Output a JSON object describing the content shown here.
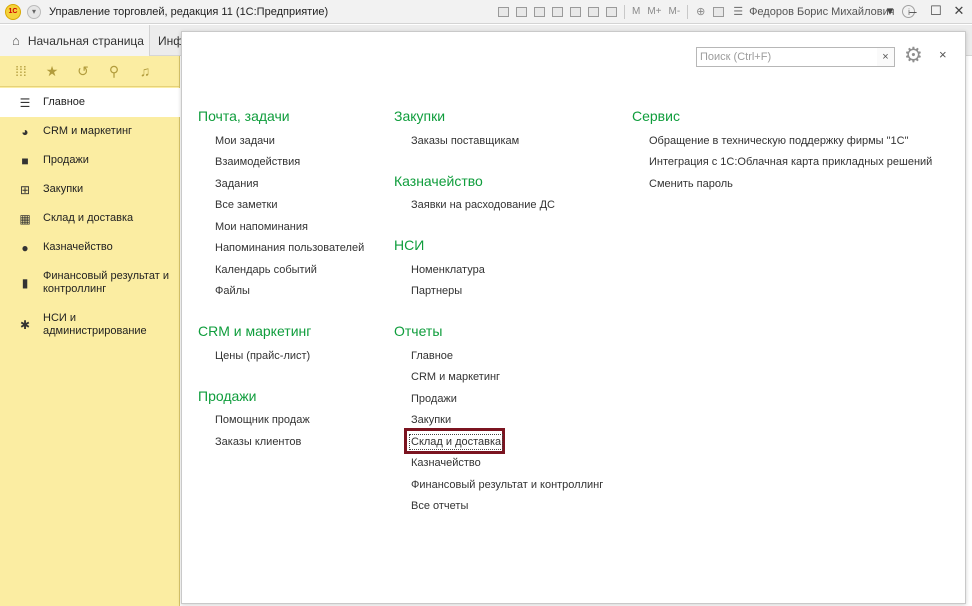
{
  "titlebar": {
    "logo": "1С",
    "title": "Управление торговлей, редакция 11  (1С:Предприятие)",
    "tools": [
      "M",
      "M+",
      "M-"
    ],
    "user": "Федоров Борис Михайлович",
    "controls": [
      "menu",
      "minimize",
      "maximize",
      "close"
    ]
  },
  "tabs": {
    "home": "Начальная страница",
    "info": "Инф"
  },
  "sidebar": {
    "quick_icons": [
      "apps-icon",
      "star-icon",
      "history-icon",
      "search-icon",
      "bell-icon"
    ],
    "items": [
      {
        "label": "Главное",
        "icon": "menu-icon"
      },
      {
        "label": "CRM и маркетинг",
        "icon": "pie-icon"
      },
      {
        "label": "Продажи",
        "icon": "bag-icon"
      },
      {
        "label": "Закупки",
        "icon": "cart-icon"
      },
      {
        "label": "Склад и доставка",
        "icon": "grid-icon"
      },
      {
        "label": "Казначейство",
        "icon": "ruble-icon"
      },
      {
        "label": "Финансовый результат и контроллинг",
        "icon": "bar-chart-icon"
      },
      {
        "label": "НСИ и администрирование",
        "icon": "gear-icon"
      }
    ]
  },
  "search": {
    "placeholder": "Поиск (Ctrl+F)",
    "value": "",
    "clear": "×"
  },
  "panel": {
    "close": "×",
    "columns": [
      {
        "sections": [
          {
            "title": "Почта, задачи",
            "items": [
              "Мои задачи",
              "Взаимодействия",
              "Задания",
              "Все заметки",
              "Мои напоминания",
              "Напоминания пользователей",
              "Календарь событий",
              "Файлы"
            ]
          },
          {
            "title": "CRM и маркетинг",
            "items": [
              "Цены (прайс-лист)"
            ]
          },
          {
            "title": "Продажи",
            "items": [
              "Помощник продаж",
              "Заказы клиентов"
            ]
          }
        ]
      },
      {
        "sections": [
          {
            "title": "Закупки",
            "items": [
              "Заказы поставщикам"
            ]
          },
          {
            "title": "Казначейство",
            "items": [
              "Заявки на расходование ДС"
            ]
          },
          {
            "title": "НСИ",
            "items": [
              "Номенклатура",
              "Партнеры"
            ]
          },
          {
            "title": "Отчеты",
            "items": [
              "Главное",
              "CRM и маркетинг",
              "Продажи",
              "Закупки",
              "Склад и доставка",
              "Казначейство",
              "Финансовый результат и контроллинг",
              "Все отчеты"
            ]
          }
        ]
      },
      {
        "sections": [
          {
            "title": "Сервис",
            "items": [
              "Обращение в техническую поддержку фирмы \"1С\"",
              "Интеграция с 1С:Облачная карта прикладных решений",
              "Сменить пароль"
            ]
          }
        ]
      }
    ]
  },
  "colors": {
    "sidebar_bg": "#fbeda2",
    "section_heading": "#0f9d3c",
    "highlight_frame": "#7b1420"
  }
}
